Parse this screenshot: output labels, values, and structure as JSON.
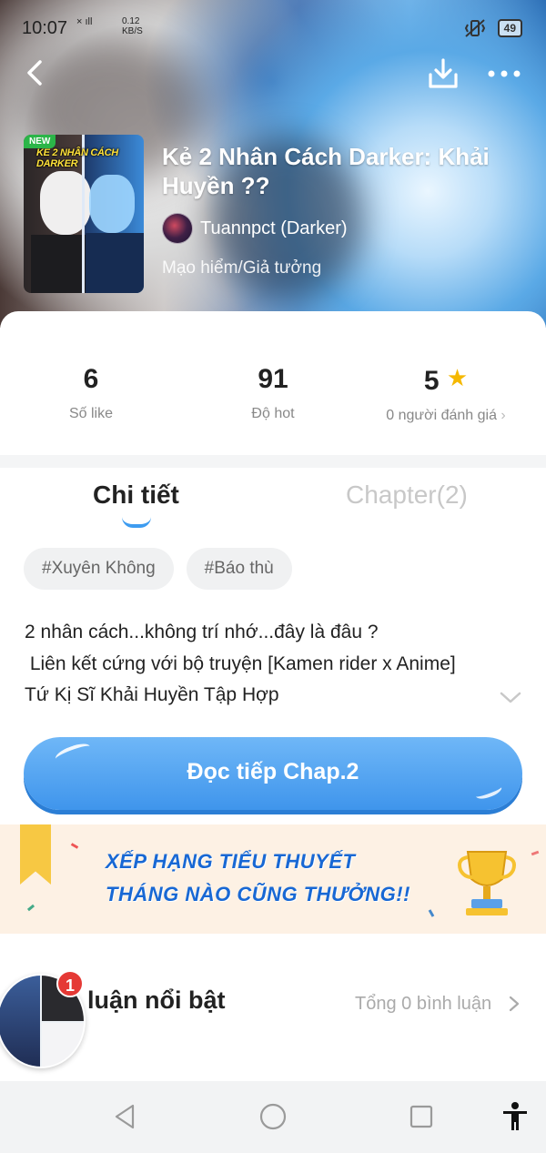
{
  "status_bar": {
    "time": "10:07",
    "network_icons": "× ıll",
    "net_speed": "0.12 KB/S",
    "battery": "49"
  },
  "header": {
    "back_icon": "back-arrow-icon",
    "download_icon": "download-icon",
    "more_icon": "more-dots-icon"
  },
  "book": {
    "badge": "NEW",
    "cover_text": "KẺ 2 NHÂN CÁCH DARKER",
    "title": "Kẻ 2 Nhân Cách Darker: Khải Huyền ??",
    "author": "Tuannpct (Darker)",
    "genre": "Mạo hiểm/Giả tưởng"
  },
  "stats": {
    "likes_value": "6",
    "likes_label": "Số like",
    "hot_value": "91",
    "hot_label": "Độ hot",
    "rating_value": "5",
    "rating_label": "0 người đánh giá"
  },
  "tabs": {
    "detail": "Chi tiết",
    "chapters": "Chapter(2)"
  },
  "tags": [
    "#Xuyên Không",
    "#Báo thù"
  ],
  "description": {
    "line1": "2 nhân cách...không trí nhớ...đây là đâu ?",
    "line2": " Liên kết cứng với bộ truyện [Kamen rider x Anime]",
    "line3": "Tứ Kị Sĩ Khải Huyền Tập Hợp"
  },
  "read_button": "Đọc tiếp Chap.2",
  "promo": {
    "line1": "XẾP HẠNG TIỂU THUYẾT",
    "line2": "THÁNG NÀO CŨNG THƯỞNG!!"
  },
  "comments": {
    "title": "luận nổi bật",
    "total": "Tổng 0 bình luận",
    "notification_count": "1"
  },
  "colors": {
    "accent": "#3e9cf0",
    "star": "#f5b800",
    "badge_red": "#e53935"
  }
}
